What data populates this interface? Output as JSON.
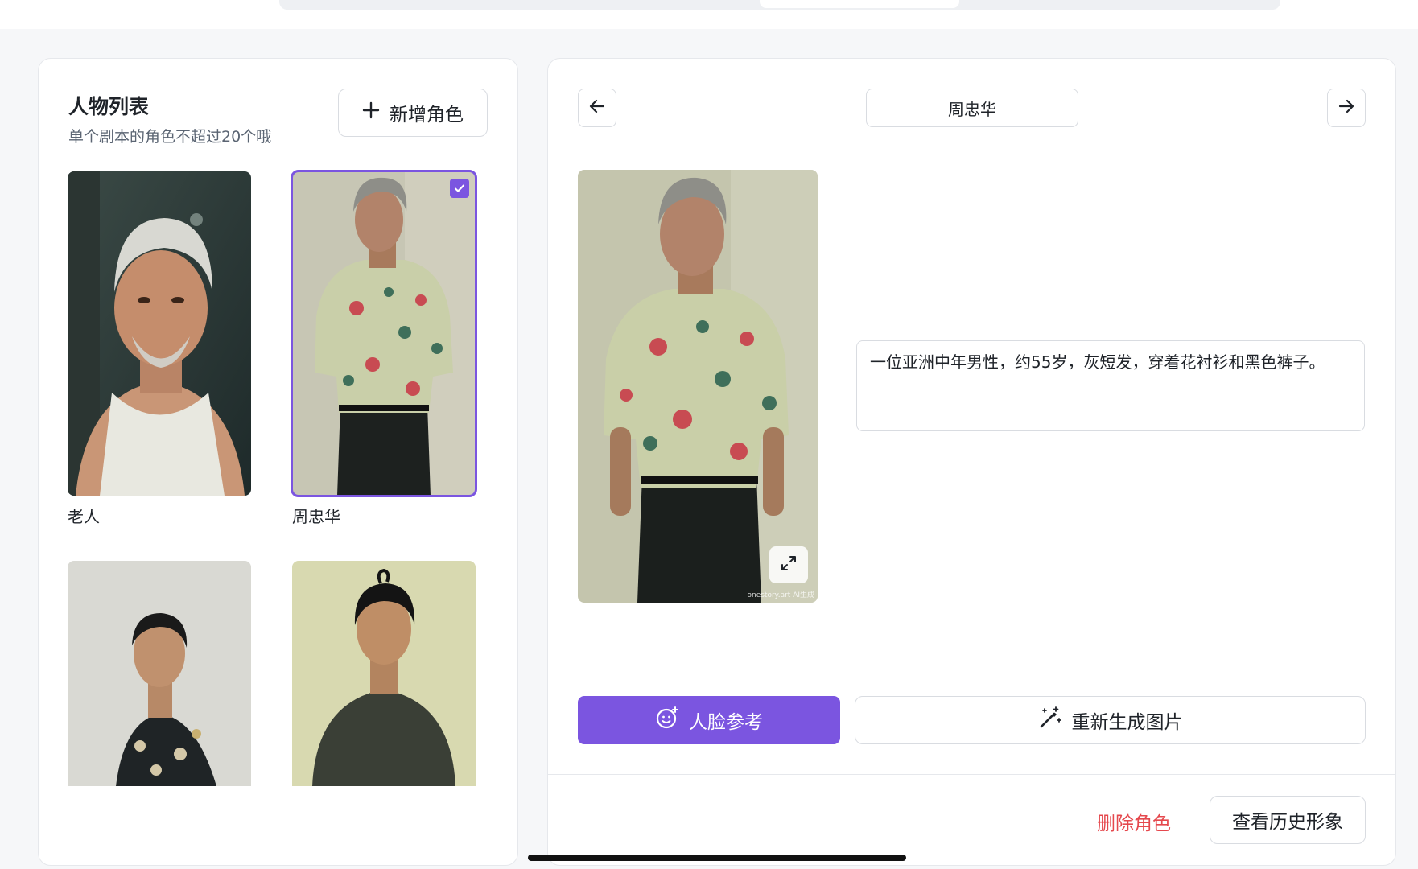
{
  "colors": {
    "accent": "#7b55e0",
    "danger": "#e5484d",
    "border": "#d9dce1"
  },
  "list": {
    "title": "人物列表",
    "subtitle": "单个剧本的角色不超过20个哦",
    "add_label": "新增角色",
    "add_icon": "plus-icon",
    "characters": [
      {
        "name": "老人",
        "selected": false
      },
      {
        "name": "周忠华",
        "selected": true
      },
      {
        "name": "",
        "selected": false
      },
      {
        "name": "",
        "selected": false
      }
    ]
  },
  "detail": {
    "prev_icon": "arrow-left-icon",
    "next_icon": "arrow-right-icon",
    "name_value": "周忠华",
    "description": "一位亚洲中年男性，约55岁，灰短发，穿着花衬衫和黑色裤子。",
    "image_watermark": "onestory.art AI生成",
    "expand_icon": "expand-icon",
    "face_ref_label": "人脸参考",
    "face_ref_icon": "face-sparkle-icon",
    "regen_label": "重新生成图片",
    "regen_icon": "magic-wand-icon",
    "delete_label": "删除角色",
    "history_label": "查看历史形象"
  }
}
